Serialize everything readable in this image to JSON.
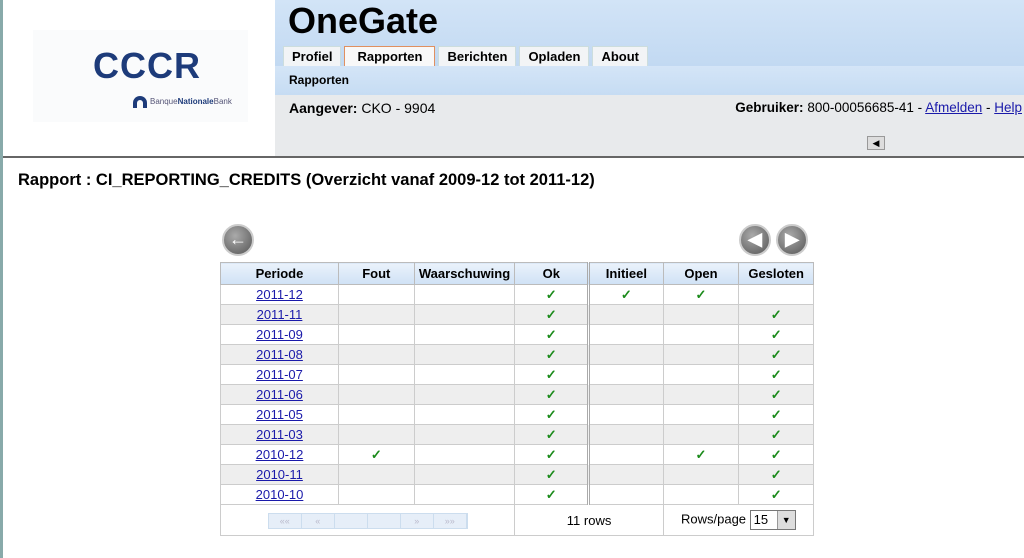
{
  "logo": {
    "name": "CCCR",
    "bank_pre": "Banque",
    "bank_mid": "Nationale",
    "bank_post": "Bank"
  },
  "app_title": "OneGate",
  "tabs": [
    {
      "label": "Profiel"
    },
    {
      "label": "Rapporten",
      "active": true
    },
    {
      "label": "Berichten"
    },
    {
      "label": "Opladen"
    },
    {
      "label": "About"
    }
  ],
  "subnav": "Rapporten",
  "aangever_label": "Aangever:",
  "aangever_value": "CKO - 9904",
  "user_label": "Gebruiker:",
  "user_value": "800-00056685-41",
  "logout": "Afmelden",
  "help": "Help",
  "report_title": "Rapport : CI_REPORTING_CREDITS (Overzicht vanaf 2009-12 tot 2011-12)",
  "table": {
    "headers": [
      "Periode",
      "Fout",
      "Waarschuwing",
      "Ok",
      "Initieel",
      "Open",
      "Gesloten"
    ],
    "rows": [
      {
        "periode": "2011-12",
        "checks": [
          false,
          false,
          true,
          true,
          true,
          false
        ]
      },
      {
        "periode": "2011-11",
        "checks": [
          false,
          false,
          true,
          false,
          false,
          true
        ]
      },
      {
        "periode": "2011-09",
        "checks": [
          false,
          false,
          true,
          false,
          false,
          true
        ]
      },
      {
        "periode": "2011-08",
        "checks": [
          false,
          false,
          true,
          false,
          false,
          true
        ]
      },
      {
        "periode": "2011-07",
        "checks": [
          false,
          false,
          true,
          false,
          false,
          true
        ]
      },
      {
        "periode": "2011-06",
        "checks": [
          false,
          false,
          true,
          false,
          false,
          true
        ]
      },
      {
        "periode": "2011-05",
        "checks": [
          false,
          false,
          true,
          false,
          false,
          true
        ]
      },
      {
        "periode": "2011-03",
        "checks": [
          false,
          false,
          true,
          false,
          false,
          true
        ]
      },
      {
        "periode": "2010-12",
        "checks": [
          true,
          false,
          true,
          false,
          true,
          true
        ]
      },
      {
        "periode": "2010-11",
        "checks": [
          false,
          false,
          true,
          false,
          false,
          true
        ]
      },
      {
        "periode": "2010-10",
        "checks": [
          false,
          false,
          true,
          false,
          false,
          true
        ]
      }
    ],
    "pager": [
      "««",
      "«",
      "",
      "",
      "»",
      "»»"
    ],
    "row_count": "11 rows",
    "rows_per_page_label": "Rows/page",
    "rows_per_page": "15"
  },
  "colors": {
    "check": "#1a8a1a",
    "header_bg": "#c6dcf3",
    "link": "#1a1aaa"
  }
}
